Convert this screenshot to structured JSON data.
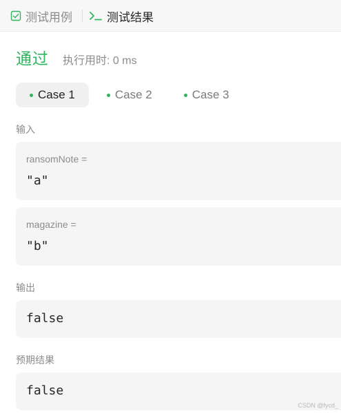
{
  "tabs": {
    "cases_label": "测试用例",
    "result_label": "测试结果",
    "cases_icon": "checkbox-icon",
    "result_icon": "terminal-icon"
  },
  "status": {
    "text": "通过",
    "runtime": "执行用时: 0 ms"
  },
  "cases": [
    "Case 1",
    "Case 2",
    "Case 3"
  ],
  "active_case": "Case 1",
  "sections": {
    "input": "输入",
    "output": "输出",
    "expected": "预期结果"
  },
  "params": [
    {
      "name": "ransomNote =",
      "value": "\"a\""
    },
    {
      "name": "magazine =",
      "value": "\"b\""
    }
  ],
  "output_value": "false",
  "expected_value": "false",
  "watermark": "CSDN @fycd_",
  "colors": {
    "accent": "#2db55d",
    "muted_text": "#8c8c8c",
    "panel_bg": "#f5f5f5"
  }
}
